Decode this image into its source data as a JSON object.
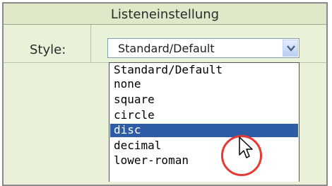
{
  "panel": {
    "title": "Listeneinstellung"
  },
  "field": {
    "label": "Style:",
    "selected_value": "Standard/Default"
  },
  "dropdown": {
    "options": [
      "Standard/Default",
      "none",
      "square",
      "circle",
      "disc",
      "decimal",
      "lower-roman"
    ],
    "highlighted_index": 4
  },
  "colors": {
    "highlight": "#2f5ca6",
    "cursor_ring": "#e53935"
  },
  "icons": {
    "select_arrow": "chevron-down-icon",
    "mouse_cursor": "arrow-cursor-icon"
  }
}
